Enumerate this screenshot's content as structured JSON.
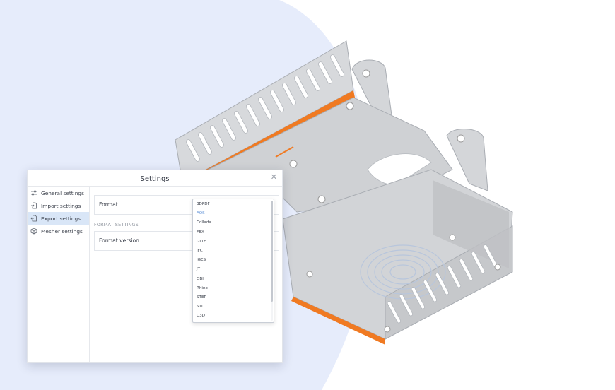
{
  "dialog": {
    "title": "Settings"
  },
  "sidebar": {
    "items": [
      {
        "label": "General settings",
        "icon": "sliders-icon"
      },
      {
        "label": "Import settings",
        "icon": "file-import-icon"
      },
      {
        "label": "Export settings",
        "icon": "file-export-icon",
        "active": true
      },
      {
        "label": "Mesher settings",
        "icon": "cube-icon"
      }
    ]
  },
  "main": {
    "format_label": "Format",
    "section_heading": "FORMAT SETTINGS",
    "format_version_label": "Format version"
  },
  "format_dropdown": {
    "selected": "AOS",
    "options": [
      "3DPDF",
      "AOS",
      "Collada",
      "FBX",
      "GLTF",
      "IFC",
      "IGES",
      "JT",
      "OBJ",
      "Rhino",
      "STEP",
      "STL",
      "U3D"
    ]
  },
  "colors": {
    "accent": "#5b8fd6",
    "active_item_bg": "#d9e6f7",
    "background_blob": "#e6ecfb",
    "edge_highlight": "#f47b20"
  }
}
